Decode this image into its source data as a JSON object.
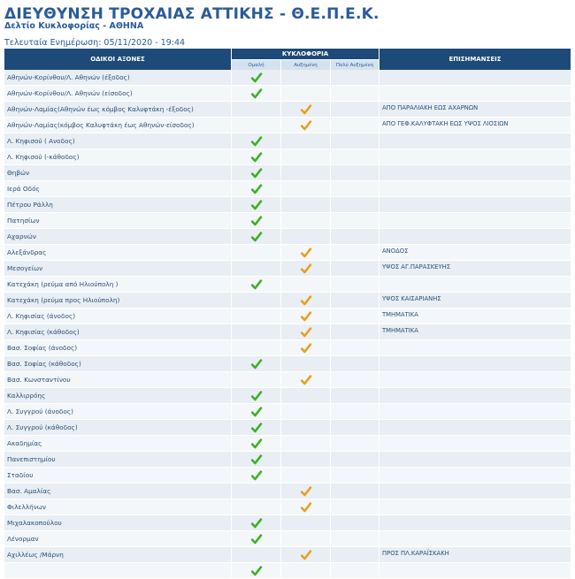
{
  "header": {
    "title": "ΔΙΕΥΘΥΝΣΗ ΤΡΟΧΑΙΑΣ ΑΤΤΙΚΗΣ - Θ.Ε.Π.Ε.Κ.",
    "subtitle": "Δελτίο Κυκλοφορίας - ΑΘΗΝΑ",
    "updated": "Τελευταία Ενημέρωση: 05/11/2020 - 19:44"
  },
  "table": {
    "col_roads": "ΟΔΙΚΟΙ ΑΞΟΝΕΣ",
    "col_traffic": "ΚΥΚΛΟΦΟΡΙΑ",
    "col_notes": "ΕΠΙΣΗΜΑΝΣΕΙΣ",
    "sub_normal": "Ομαλή",
    "sub_increased": "Αυξημένη",
    "sub_very_increased": "Πολύ Αυξημένη",
    "rows": [
      {
        "road": "Αθηνών-Κορίνθου/Λ. Αθηνών (έξοδος)",
        "status": "normal",
        "note": ""
      },
      {
        "road": "Αθηνών-Κορίνθου/Λ. Αθηνών (είσοδος)",
        "status": "normal",
        "note": ""
      },
      {
        "road": "Αθηνών-Λαμίας(Αθηνών έως κόμβος Καλυφτάκη -έξοδος)",
        "status": "increased",
        "note": "ΑΠΟ ΠΑΡΑΛΙΑΚΗ ΕΩΣ ΑΧΑΡΝΩΝ"
      },
      {
        "road": "Αθηνών-Λαμίας(κόμβος Καλυφτάκη έως Αθηνών-είσοδος)",
        "status": "increased",
        "note": "ΑΠΟ ΓΕΦ.ΚΑΛΥΦΤΑΚΗ ΕΩΣ ΥΨΟΣ ΛΙΟΣΙΩΝ"
      },
      {
        "road": "Λ. Κηφισού ( Ανοδος)",
        "status": "normal",
        "note": ""
      },
      {
        "road": "Λ. Κηφισού (-κάθοδος)",
        "status": "normal",
        "note": ""
      },
      {
        "road": "Θηβών",
        "status": "normal",
        "note": ""
      },
      {
        "road": "Ιερά Οδός",
        "status": "normal",
        "note": ""
      },
      {
        "road": "Πέτρου Ράλλη",
        "status": "normal",
        "note": ""
      },
      {
        "road": "Πατησίων",
        "status": "normal",
        "note": ""
      },
      {
        "road": "Αχαρνών",
        "status": "normal",
        "note": ""
      },
      {
        "road": "Αλεξάνδρας",
        "status": "increased",
        "note": "ΑΝΟΔΟΣ"
      },
      {
        "road": "Μεσογείων",
        "status": "increased",
        "note": "ΥΨΟΣ ΑΓ.ΠΑΡΑΣΚΕΥΗΣ"
      },
      {
        "road": "Κατεχάκη (ρεύμα από Ηλιούπολη )",
        "status": "normal",
        "note": ""
      },
      {
        "road": "Κατεχάκη (ρεύμα προς Ηλιούπολη)",
        "status": "increased",
        "note": "ΥΨΟΣ ΚΑΙΣΑΡΙΑΝΗΣ"
      },
      {
        "road": "Λ. Κηφισίας (άνοδος)",
        "status": "increased",
        "note": "ΤΜΗΜΑΤΙΚΑ"
      },
      {
        "road": "Λ. Κηφισίας (κάθοδος)",
        "status": "increased",
        "note": "ΤΜΗΜΑΤΙΚΑ"
      },
      {
        "road": "Βασ. Σοφίας (άνοδος)",
        "status": "increased",
        "note": ""
      },
      {
        "road": "Βασ. Σοφίας (κάθοδος)",
        "status": "normal",
        "note": ""
      },
      {
        "road": "Βασ. Κωνσταντίνου",
        "status": "increased",
        "note": ""
      },
      {
        "road": "Καλλιρρόης",
        "status": "normal",
        "note": ""
      },
      {
        "road": "Λ. Συγγρού (άνοδος)",
        "status": "normal",
        "note": ""
      },
      {
        "road": "Λ. Συγγρού (κάθοδος)",
        "status": "normal",
        "note": ""
      },
      {
        "road": "Ακαδημίας",
        "status": "normal",
        "note": ""
      },
      {
        "road": "Πανεπιστημίου",
        "status": "normal",
        "note": ""
      },
      {
        "road": "Σταδίου",
        "status": "normal",
        "note": ""
      },
      {
        "road": "Βασ. Αμαλίας",
        "status": "increased",
        "note": ""
      },
      {
        "road": "Φιλελλήνων",
        "status": "increased",
        "note": ""
      },
      {
        "road": "Μιχαλακοπούλου",
        "status": "normal",
        "note": ""
      },
      {
        "road": "Λένορμαν",
        "status": "normal",
        "note": ""
      },
      {
        "road": "Αχιλλέως /Μάρνη",
        "status": "increased",
        "note": "ΠΡΟΣ ΠΛ.ΚΑΡΑΪΣΚΑΚΗ"
      },
      {
        "road": "",
        "status": "normal",
        "note": ""
      }
    ]
  },
  "icons": {
    "normal": "green-check-icon",
    "increased": "orange-check-icon"
  },
  "colors": {
    "header_bg": "#1d4a78",
    "title": "#2a5b9a",
    "normal": "#3fae2a",
    "increased": "#e6a020"
  }
}
